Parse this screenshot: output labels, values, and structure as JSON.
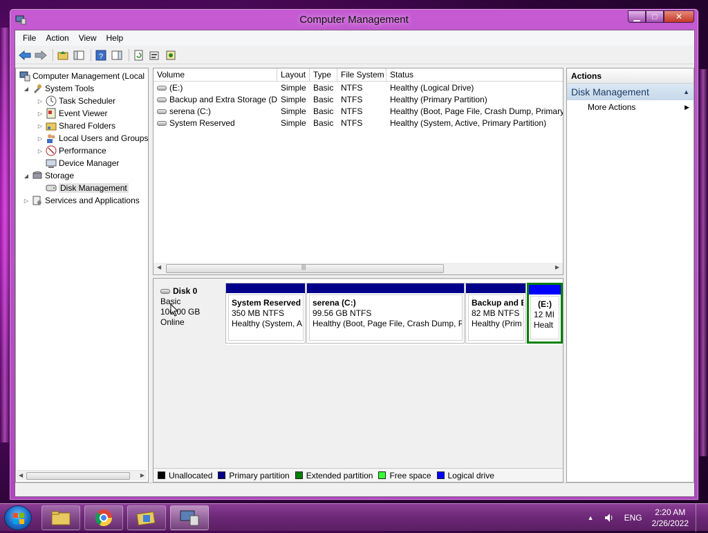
{
  "window": {
    "title": "Computer Management",
    "min": "▁",
    "max": "□",
    "close": "✕"
  },
  "menu": [
    "File",
    "Action",
    "View",
    "Help"
  ],
  "tree": {
    "root": "Computer Management (Local",
    "system_tools": "System Tools",
    "task_scheduler": "Task Scheduler",
    "event_viewer": "Event Viewer",
    "shared_folders": "Shared Folders",
    "local_users": "Local Users and Groups",
    "performance": "Performance",
    "device_manager": "Device Manager",
    "storage": "Storage",
    "disk_management": "Disk Management",
    "services": "Services and Applications"
  },
  "volumes": {
    "headers": [
      "Volume",
      "Layout",
      "Type",
      "File System",
      "Status"
    ],
    "rows": [
      [
        "(E:)",
        "Simple",
        "Basic",
        "NTFS",
        "Healthy (Logical Drive)"
      ],
      [
        "Backup and Extra Storage (D:)",
        "Simple",
        "Basic",
        "NTFS",
        "Healthy (Primary Partition)"
      ],
      [
        "serena (C:)",
        "Simple",
        "Basic",
        "NTFS",
        "Healthy (Boot, Page File, Crash Dump, Primary P"
      ],
      [
        "System Reserved",
        "Simple",
        "Basic",
        "NTFS",
        "Healthy (System, Active, Primary Partition)"
      ]
    ],
    "scroll_left": "◀",
    "scroll_right": "▶",
    "scroll_grip": "|||"
  },
  "disk": {
    "name": "Disk 0",
    "type": "Basic",
    "size": "100.00 GB",
    "state": "Online",
    "partitions": [
      {
        "title": "System Reserved",
        "size": "350 MB NTFS",
        "status": "Healthy (System, A"
      },
      {
        "title": "serena  (C:)",
        "size": "99.56 GB NTFS",
        "status": "Healthy (Boot, Page File, Crash Dump, Pr"
      },
      {
        "title": "Backup and E",
        "size": "82 MB NTFS",
        "status": "Healthy (Prim"
      },
      {
        "title": "(E:)",
        "size": "12 MI",
        "status": "Healt"
      }
    ]
  },
  "legend": [
    {
      "label": "Unallocated",
      "color": "#000000"
    },
    {
      "label": "Primary partition",
      "color": "#00008b"
    },
    {
      "label": "Extended partition",
      "color": "#008000"
    },
    {
      "label": "Free space",
      "color": "#33ff33"
    },
    {
      "label": "Logical drive",
      "color": "#0000ff"
    }
  ],
  "actions": {
    "header": "Actions",
    "section": "Disk Management",
    "more": "More Actions"
  },
  "taskbar": {
    "lang": "ENG",
    "time": "2:20 AM",
    "date": "2/26/2022"
  }
}
